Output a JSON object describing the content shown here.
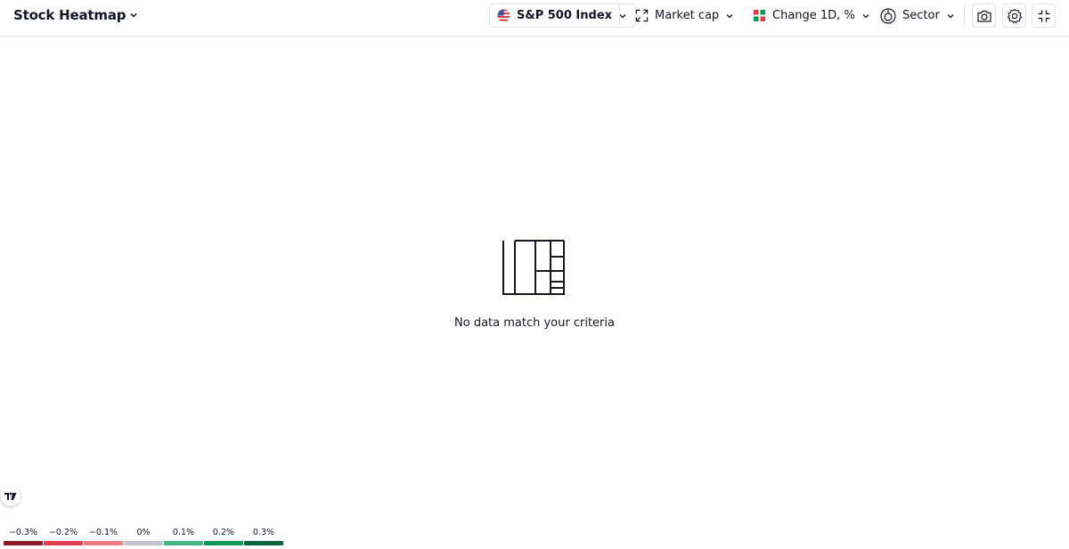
{
  "header": {
    "title": "Stock Heatmap",
    "index_label": "S&P 500 Index",
    "size_label": "Market cap",
    "color_label": "Change 1D, %",
    "group_label": "Sector"
  },
  "empty_state": {
    "message": "No data match your criteria"
  },
  "legend": [
    {
      "label": "−0.3%",
      "color": "#8e1b25"
    },
    {
      "label": "−0.2%",
      "color": "#e03d4e"
    },
    {
      "label": "−0.1%",
      "color": "#f07b85"
    },
    {
      "label": "0%",
      "color": "#c1c4cd"
    },
    {
      "label": "0.1%",
      "color": "#44b785"
    },
    {
      "label": "0.2%",
      "color": "#0e9a5a"
    },
    {
      "label": "0.3%",
      "color": "#08683b"
    }
  ],
  "icons": {
    "index_flag": "us-flag-icon",
    "size": "expand-icon",
    "color": "color-grid-icon",
    "group": "sector-icon",
    "screenshot": "camera-icon",
    "settings": "gear-icon",
    "fullscreen": "collapse-icon",
    "logo": "tradingview-logo",
    "empty": "heatmap-icon"
  }
}
